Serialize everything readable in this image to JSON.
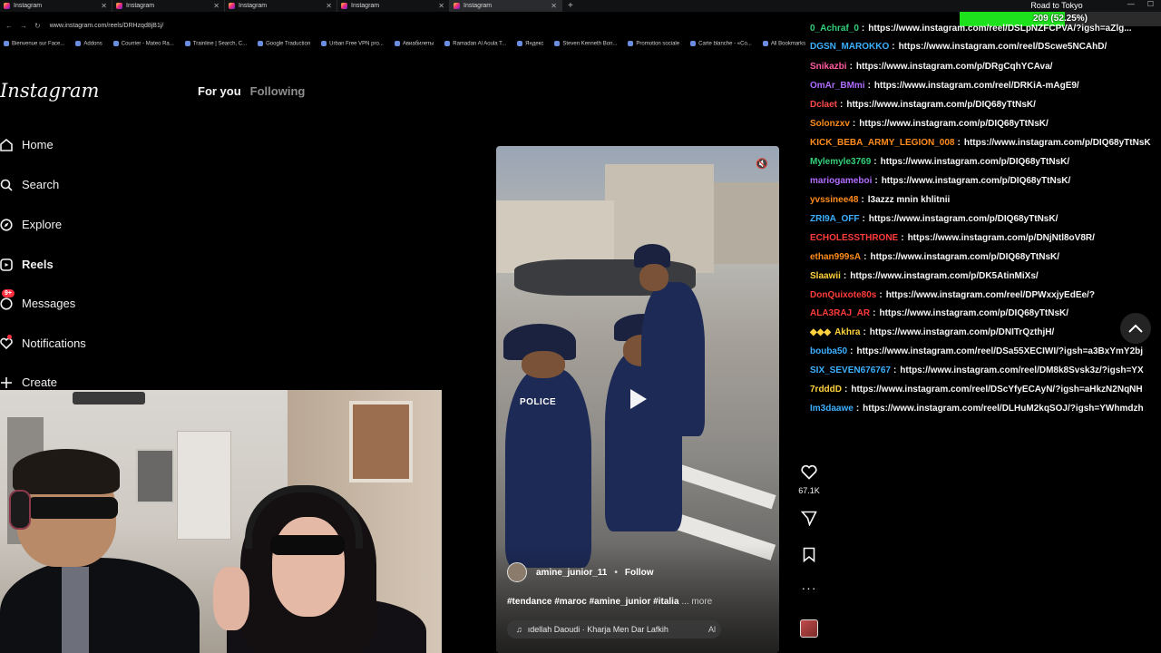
{
  "browser": {
    "tabs": [
      {
        "label": "Instagram"
      },
      {
        "label": "Instagram"
      },
      {
        "label": "Instagram"
      },
      {
        "label": "Instagram"
      },
      {
        "label": "Instagram"
      }
    ],
    "url": "www.instagram.com/reels/DRHzqd8jB1j/",
    "bookmarks": [
      "Bienvenue sur Face...",
      "Addons",
      "Courrier - Mateo Ra...",
      "Trainline | Search, C...",
      "Google Traduction",
      "Urban Free VPN pro...",
      "Авиабилеты",
      "Ramadan Al Aoula T...",
      "Яндекс",
      "Steven Kenneth Bon...",
      "Promotion sociale",
      "Carte blanche - «Co...",
      "All Bookmarks"
    ]
  },
  "sidebar": {
    "logo": "Instagram",
    "items": [
      {
        "label": "Home"
      },
      {
        "label": "Search"
      },
      {
        "label": "Explore"
      },
      {
        "label": "Reels"
      },
      {
        "label": "Messages",
        "badge": "9+"
      },
      {
        "label": "Notifications"
      },
      {
        "label": "Create"
      }
    ]
  },
  "feed_tabs": {
    "for_you": "For you",
    "following": "Following"
  },
  "reel": {
    "author": "amine_junior_11",
    "follow": "Follow",
    "caption": "#tendance #maroc #amine_junior #italia",
    "more": "... more",
    "audio": "ıdellah Daoudi · Kharja Men Dar Lafkih",
    "audio_tail": "Al",
    "sign": "POLICE",
    "likes": "67.1K"
  },
  "goal": {
    "title": "Road to Tokyo",
    "text": "209 (52.25%)",
    "fraction": 0.5225,
    "color": "#1ee11e"
  },
  "chat": [
    {
      "user": "0_Achraf_0",
      "color": "#33d17a",
      "text": "https://www.instagram.com/reel/DSLpNZFCPVA/?igsh=aZlg..."
    },
    {
      "user": "DGSN_MAROKKO",
      "color": "#3cb0ff",
      "text": "https://www.instagram.com/reel/DScwe5NCAhD/"
    },
    {
      "user": "Snikazbi",
      "color": "#ff5aa0",
      "text": "https://www.instagram.com/p/DRgCqhYCAva/"
    },
    {
      "user": "OmAr_BMmi",
      "color": "#b06cff",
      "text": "https://www.instagram.com/reel/DRKiA-mAgE9/"
    },
    {
      "user": "Dclaet",
      "color": "#ff4b4b",
      "text": "https://www.instagram.com/p/DIQ68yTtNsK/"
    },
    {
      "user": "Solonzxv",
      "color": "#ff8c1a",
      "text": "https://www.instagram.com/p/DIQ68yTtNsK/"
    },
    {
      "user": "KICK_BEBA_ARMY_LEGION_008",
      "color": "#ff8c1a",
      "text": "https://www.instagram.com/p/DIQ68yTtNsK"
    },
    {
      "user": "Mylemyle3769",
      "color": "#33d17a",
      "text": "https://www.instagram.com/p/DIQ68yTtNsK/"
    },
    {
      "user": "mariogameboi",
      "color": "#b06cff",
      "text": "https://www.instagram.com/p/DIQ68yTtNsK/"
    },
    {
      "user": "yvssinee48",
      "color": "#ff8c1a",
      "text": "l3azzz mnin khlitnii"
    },
    {
      "user": "ZRI9A_OFF",
      "color": "#3cb0ff",
      "text": "https://www.instagram.com/p/DIQ68yTtNsK/"
    },
    {
      "user": "ECHOLESSTHRONE",
      "color": "#ff3b3b",
      "text": "https://www.instagram.com/p/DNjNtl8oV8R/"
    },
    {
      "user": "ethan999sA",
      "color": "#ff8c1a",
      "text": "https://www.instagram.com/p/DIQ68yTtNsK/"
    },
    {
      "user": "Slaawii",
      "color": "#ffd23c",
      "text": "https://www.instagram.com/p/DK5AtinMiXs/"
    },
    {
      "user": "DonQuixote80s",
      "color": "#ff3b3b",
      "text": "https://www.instagram.com/reel/DPWxxjyEdEe/?"
    },
    {
      "user": "ALA3RAJ_AR",
      "color": "#ff3b3b",
      "text": "https://www.instagram.com/p/DIQ68yTtNsK/"
    },
    {
      "user": "Akhra",
      "color": "#ffd23c",
      "text": "https://www.instagram.com/p/DNITrQzthjH/",
      "badges": true
    },
    {
      "user": "bouba50",
      "color": "#3cb0ff",
      "text": "https://www.instagram.com/reel/DSa55XECIWI/?igsh=a3BxYmY2bj"
    },
    {
      "user": "SIX_SEVEN676767",
      "color": "#3cb0ff",
      "text": "https://www.instagram.com/reel/DM8k8Svsk3z/?igsh=YX"
    },
    {
      "user": "7rdddD",
      "color": "#ffd23c",
      "text": "https://www.instagram.com/reel/DScYfyECAyN/?igsh=aHkzN2NqNH"
    },
    {
      "user": "Im3daawe",
      "color": "#3cb0ff",
      "text": "https://www.instagram.com/reel/DLHuM2kqSOJ/?igsh=YWhmdzh"
    }
  ]
}
